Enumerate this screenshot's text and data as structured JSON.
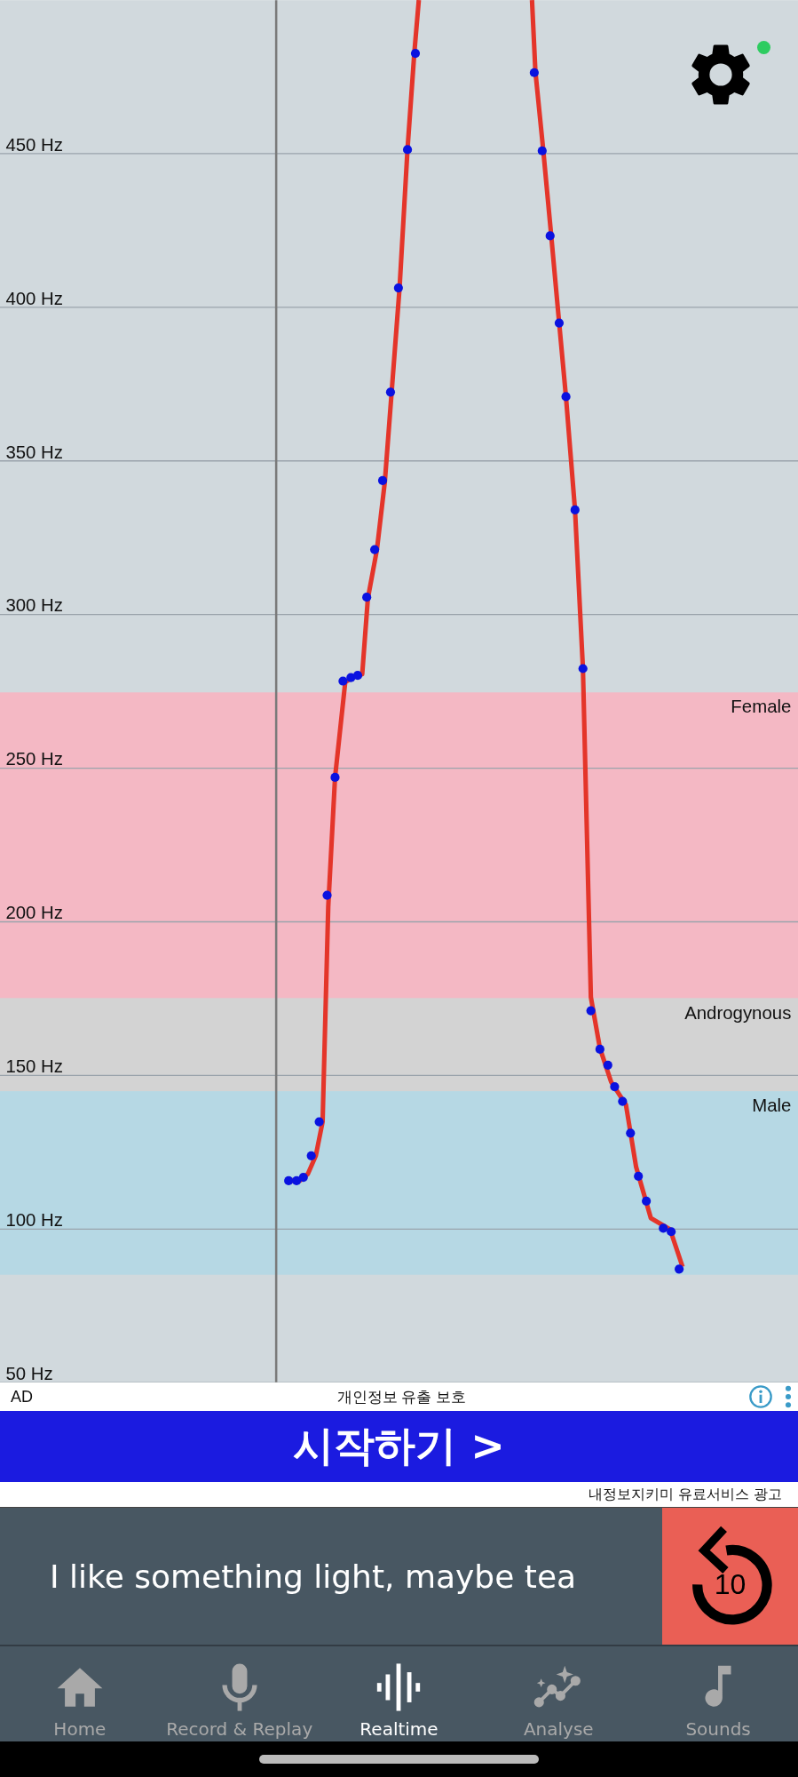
{
  "pitch_graph": {
    "y_labels": [
      "450 Hz",
      "400 Hz",
      "350 Hz",
      "300 Hz",
      "250 Hz",
      "200 Hz",
      "150 Hz",
      "100 Hz",
      "50 Hz"
    ],
    "bands": [
      {
        "label": "Female",
        "color": "#f4b8c4"
      },
      {
        "label": "Androgynous",
        "color": "#d3d3d3"
      },
      {
        "label": "Male",
        "color": "#b6d8e4"
      }
    ],
    "settings": {
      "status_on": true
    }
  },
  "ad": {
    "badge": "AD",
    "headline": "개인정보 유출 보호",
    "cta": "시작하기 >",
    "footer": "내정보지키미 유료서비스 광고"
  },
  "phrase": {
    "text": "I like something light, maybe tea",
    "replay_seconds": "10"
  },
  "nav": [
    {
      "label": "Home",
      "selected": false
    },
    {
      "label": "Record & Replay",
      "selected": false
    },
    {
      "label": "Realtime",
      "selected": true
    },
    {
      "label": "Analyse",
      "selected": false
    },
    {
      "label": "Sounds",
      "selected": false
    }
  ]
}
